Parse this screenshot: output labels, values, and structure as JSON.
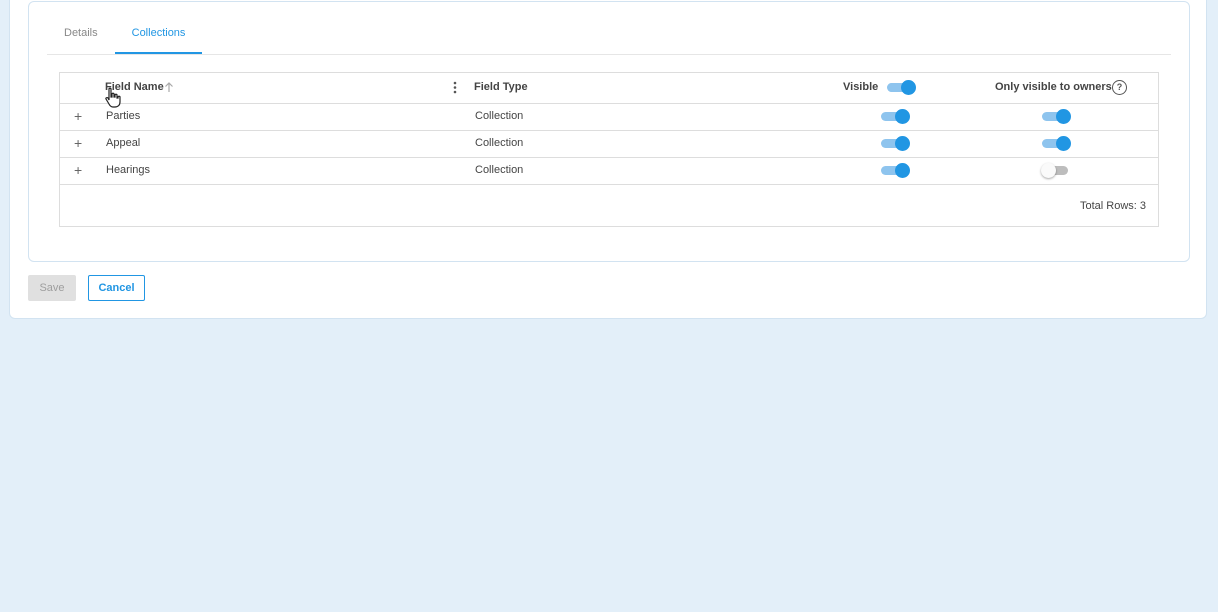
{
  "tabs": [
    {
      "label": "Details",
      "active": false
    },
    {
      "label": "Collections",
      "active": true
    }
  ],
  "grid": {
    "columns": {
      "field_name": "Field Name",
      "field_type": "Field Type",
      "visible": "Visible",
      "only_visible_to_owners": "Only visible to owners"
    },
    "header_visible_toggle": true,
    "rows": [
      {
        "expand": "+",
        "name": "Parties",
        "type": "Collection",
        "visible": true,
        "owners_only": true
      },
      {
        "expand": "+",
        "name": "Appeal",
        "type": "Collection",
        "visible": true,
        "owners_only": true
      },
      {
        "expand": "+",
        "name": "Hearings",
        "type": "Collection",
        "visible": true,
        "owners_only": false
      }
    ],
    "total_rows": "Total Rows: 3"
  },
  "buttons": {
    "save": "Save",
    "cancel": "Cancel"
  },
  "icons": {
    "sort": "arrow-up-icon",
    "menu": "kebab-menu-icon",
    "help": "question-circle-icon",
    "cursor": "hand-pointer-icon"
  },
  "colors": {
    "accent": "#2196e3",
    "background": "#e3eff9"
  }
}
